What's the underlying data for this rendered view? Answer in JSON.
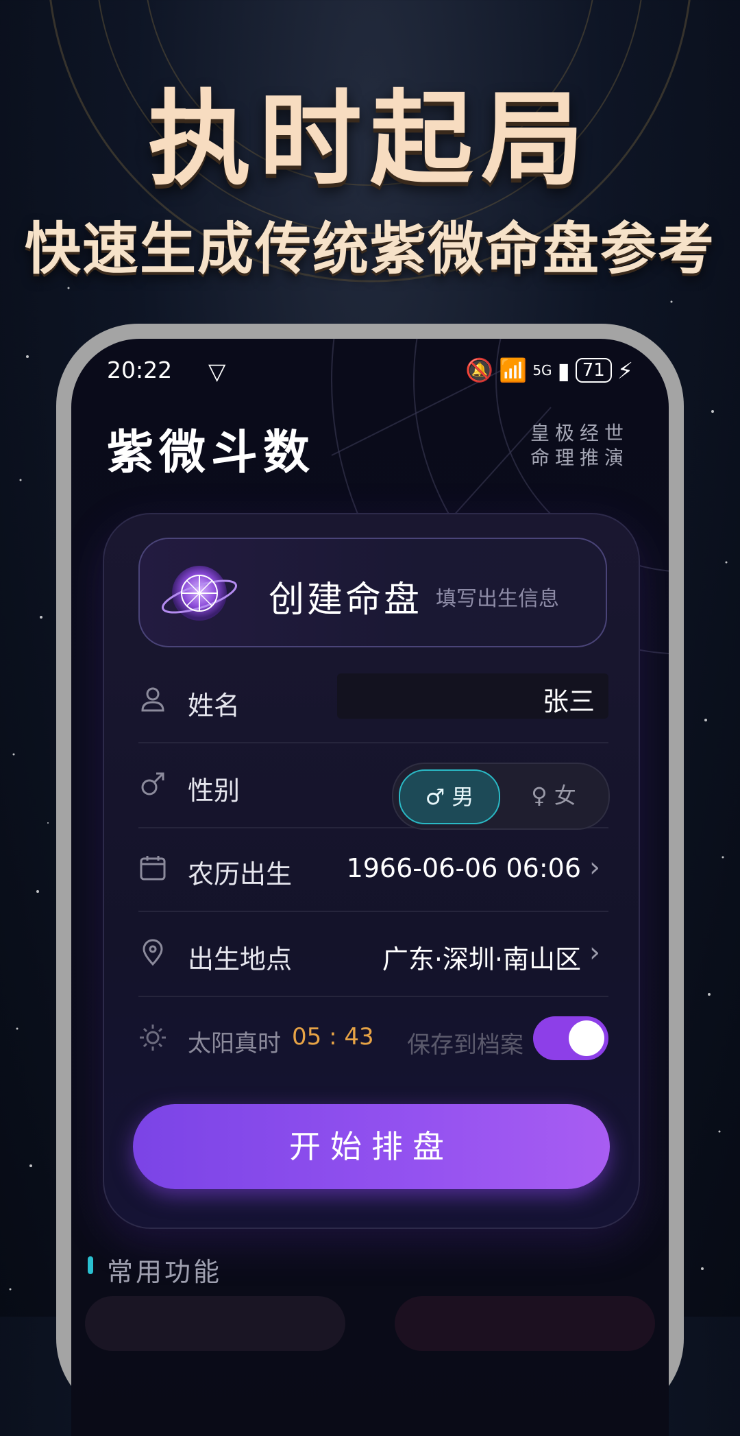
{
  "hero": {
    "title": "执时起局",
    "subtitle": "快速生成传统紫微命盘参考"
  },
  "status_bar": {
    "time": "20:22",
    "battery": "71",
    "network": "5G"
  },
  "app": {
    "title": "紫微斗数",
    "tag": "皇极经世命理推演"
  },
  "create_card": {
    "title": "创建命盘",
    "hint": "填写出生信息"
  },
  "form": {
    "name": {
      "label": "姓名",
      "value": "张三"
    },
    "gender": {
      "label": "性别",
      "male": "♂ 男",
      "female": "♀ 女",
      "selected": "male"
    },
    "lunar_birth": {
      "label": "农历出生",
      "value": "1966-06-06 06:06"
    },
    "birthplace": {
      "label": "出生地点",
      "value": "广东·深圳·南山区"
    },
    "solar_time": {
      "label": "太阳真时",
      "value": "05 : 43"
    },
    "save": {
      "label": "保存到档案",
      "enabled": true
    }
  },
  "start_button": "开始排盘",
  "section": {
    "title": "常用功能"
  },
  "colors": {
    "accent_purple": "#8d3fe8",
    "accent_cyan": "#2ac0d0",
    "time_orange": "#e8a446"
  }
}
